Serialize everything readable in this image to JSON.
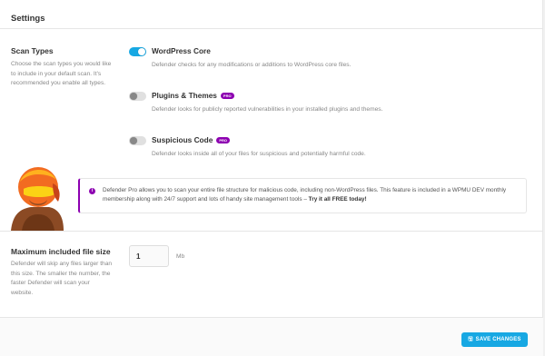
{
  "header": {
    "title": "Settings"
  },
  "scan_types": {
    "label": "Scan Types",
    "description": "Choose the scan types you would like to include in your default scan. It's recommended you enable all types.",
    "options": [
      {
        "title": "WordPress Core",
        "enabled": true,
        "pro": false,
        "description": "Defender checks for any modifications or additions to WordPress core files."
      },
      {
        "title": "Plugins & Themes",
        "enabled": false,
        "pro": true,
        "pro_label": "PRO",
        "description": "Defender looks for publicly reported vulnerabilities in your installed plugins and themes."
      },
      {
        "title": "Suspicious Code",
        "enabled": false,
        "pro": true,
        "pro_label": "PRO",
        "description": "Defender looks inside all of your files for suspicious and potentially harmful code."
      }
    ]
  },
  "notice": {
    "text": "Defender Pro allows you to scan your entire file structure for malicious code, including non-WordPress files. This feature is included in a WPMU DEV monthly membership along with 24/7 support and lots of handy site management tools – ",
    "cta": "Try it all FREE today!"
  },
  "file_size": {
    "label": "Maximum included file size",
    "description": "Defender will skip any files larger than this size. The smaller the number, the faster Defender will scan your website.",
    "value": "1",
    "unit": "Mb"
  },
  "footer": {
    "save_label": "SAVE CHANGES"
  },
  "colors": {
    "accent": "#17a8e3",
    "pro": "#8d00b1"
  }
}
